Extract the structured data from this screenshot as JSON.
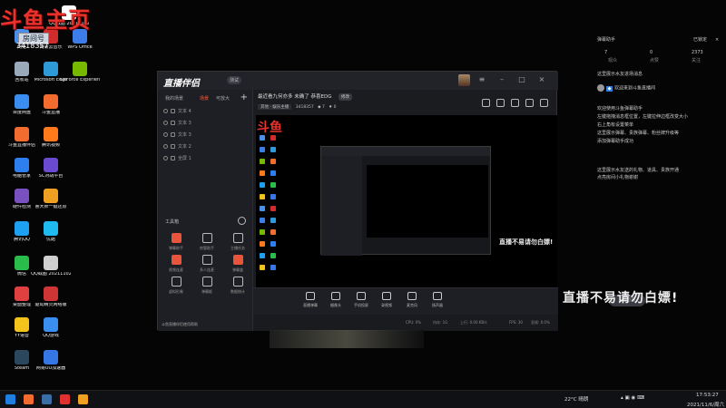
{
  "overlay": {
    "logo_text": "斗鱼主页",
    "nickname_badge": "房间号",
    "room_number": "3418357"
  },
  "desktop_icons": [
    {
      "label": "QQ截图 20211102...",
      "color": "#ffffff"
    },
    {
      "label": "网络",
      "color": "#4a8fe8"
    },
    {
      "label": "网易云音乐",
      "color": "#d12c2c"
    },
    {
      "label": "WPS Office",
      "color": "#3c7de8"
    },
    {
      "label": "回收站",
      "color": "#9ab"
    },
    {
      "label": "Microsoft Edge",
      "color": "#2f9ad8"
    },
    {
      "label": "GeForce Experience",
      "color": "#76b900"
    },
    {
      "label": "百度网盘",
      "color": "#3a8ef0"
    },
    {
      "label": "斗鱼直播",
      "color": "#f26c2f"
    },
    {
      "label": "斗鱼直播伴侣",
      "color": "#f26c2f"
    },
    {
      "label": "腾讯视频",
      "color": "#ff7a1a"
    },
    {
      "label": "电脑管家",
      "color": "#2d7ff0"
    },
    {
      "label": "SC对战平台",
      "color": "#6a4bd0"
    },
    {
      "label": "硬件检测",
      "color": "#7a4fbf"
    },
    {
      "label": "鲁大师一键还原",
      "color": "#f0a020"
    },
    {
      "label": "腾讯QQ",
      "color": "#1da0f2"
    },
    {
      "label": "优酷",
      "color": "#1ebbf0"
    },
    {
      "label": "微信",
      "color": "#2bbd4b"
    },
    {
      "label": "QQ截图 20211102...",
      "color": "#cfcfcf"
    },
    {
      "label": "桌面整理",
      "color": "#e04040"
    },
    {
      "label": "驱动精灵网络版",
      "color": "#d03535"
    },
    {
      "label": "YY语音",
      "color": "#f3c21b"
    },
    {
      "label": "QQ游戏",
      "color": "#3a8ef0"
    },
    {
      "label": "Steam",
      "color": "#2a475e"
    },
    {
      "label": "网易UU加速器",
      "color": "#3577e5"
    }
  ],
  "app": {
    "title": "直播伴侣",
    "version_badge": "测试",
    "tabs": [
      "我的场景",
      "场景",
      "可放大"
    ],
    "add_label": "+",
    "sources": [
      "文本 4",
      "文本 3",
      "文本 3",
      "文本 2",
      "全屏 1"
    ],
    "tools_title": "工具箱",
    "tools": [
      {
        "label": "弹幕助手",
        "hot": true
      },
      {
        "label": "房管助手",
        "hot": false
      },
      {
        "label": "主播任务",
        "hot": false
      },
      {
        "label": "视频连麦",
        "hot": true
      },
      {
        "label": "多人连麦",
        "hot": false
      },
      {
        "label": "弹幕盒",
        "hot": true
      },
      {
        "label": "虚拟形象",
        "hot": false
      },
      {
        "label": "弹幕姬",
        "hot": false
      },
      {
        "label": "数据统计",
        "hot": false
      }
    ],
    "footer_notice": "斗鱼直播伴侣使用帮助",
    "stream_title": "最近看九何亦多 未确了 恭喜EDG",
    "edit_label": "修改",
    "stats": {
      "category": "其他 · 娱乐主播",
      "room": "3418357",
      "viewers": "7",
      "likes": "0"
    },
    "preview_slogan": "直播不易请勿白嫖!",
    "bottom_buttons": [
      "直播弹幕",
      "摄像头",
      "手机投屏",
      "录视频",
      "麦克风",
      "扬声器"
    ],
    "go_live": "开始直播",
    "status": [
      "CPU: 0%",
      "内存: 1G",
      "上行: 0.00 KB/s",
      "FPS: 30",
      "丢帧: 0.0%"
    ]
  },
  "rpanel": {
    "header": "弹幕助手",
    "status": "已锁定",
    "counts": [
      "7",
      "0",
      "2373"
    ],
    "count_labels": [
      "观众",
      "点赞",
      "关注"
    ],
    "welcome_note": "这里展示水友进场消息",
    "welcome_msg": "欢迎来到斗鱼直播间",
    "tips": [
      "欢迎使用斗鱼弹幕助手",
      "左键拖拽消息框位置，左键拉伸边框改变大小",
      "右上角有设置菜单",
      "这里展示弹幕、贵族弹幕、粉丝牌升级等",
      "添加弹幕助手成功"
    ],
    "gift_notes": [
      "这里展示水友送的礼物、道具、贵族开通",
      "点亮房间小礼物谢谢"
    ]
  },
  "big_slogan": "直播不易请勿白嫖!",
  "taskbar": {
    "weather": "22°C 晴朗",
    "time": "17:53:27",
    "date": "2021/11/6/周六"
  }
}
